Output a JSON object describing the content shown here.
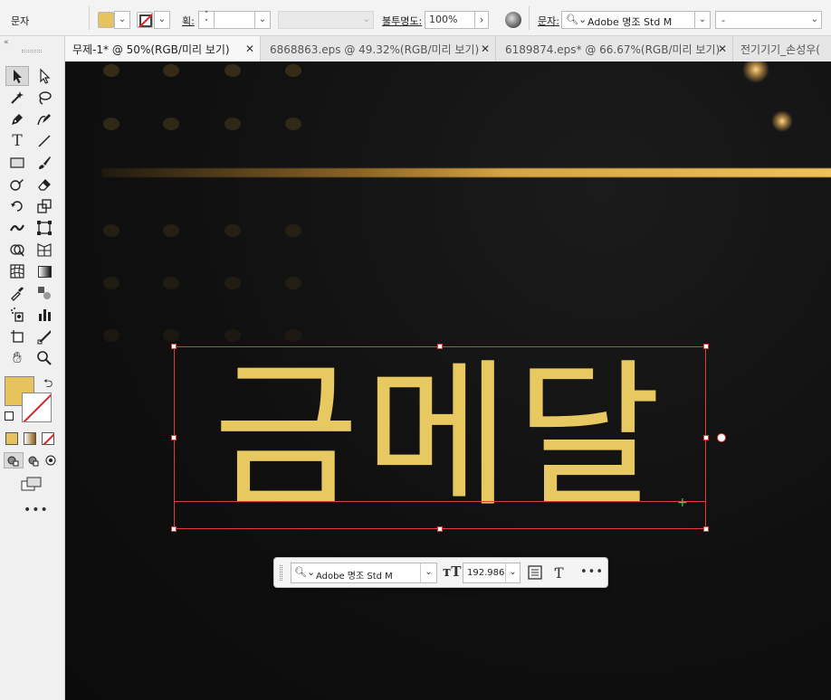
{
  "control_bar": {
    "object_label": "문자",
    "fill_color": "#e6c35c",
    "stroke_label": "획:",
    "stroke_value": "",
    "opacity_label": "불투명도:",
    "opacity_value": "100%",
    "character_label": "문자:",
    "font_family": "Adobe 명조 Std M",
    "font_style": "-"
  },
  "tabs": [
    {
      "label": "무제-1* @ 50%(RGB/미리 보기)",
      "active": true
    },
    {
      "label": "6868863.eps @ 49.32%(RGB/미리 보기)",
      "active": false
    },
    {
      "label": "6189874.eps* @ 66.67%(RGB/미리 보기)",
      "active": false
    },
    {
      "label": "전기기기_손성우(",
      "active": false
    }
  ],
  "artwork": {
    "headline": "금메달",
    "text_color": "#e8c860"
  },
  "task_bar": {
    "font_family": "Adobe 명조 Std M",
    "font_size": "192.986"
  },
  "tool_icons": [
    "selection-icon",
    "direct-selection-icon",
    "magic-wand-icon",
    "lasso-icon",
    "pen-icon",
    "curvature-icon",
    "type-icon",
    "line-segment-icon",
    "rectangle-icon",
    "paintbrush-icon",
    "shaper-icon",
    "eraser-icon",
    "rotate-icon",
    "scale-icon",
    "width-icon",
    "free-transform-icon",
    "shape-builder-icon",
    "perspective-grid-icon",
    "mesh-icon",
    "gradient-icon",
    "eyedropper-icon",
    "blend-icon",
    "symbol-sprayer-icon",
    "column-graph-icon",
    "artboard-icon",
    "slice-icon",
    "hand-icon",
    "zoom-icon"
  ]
}
